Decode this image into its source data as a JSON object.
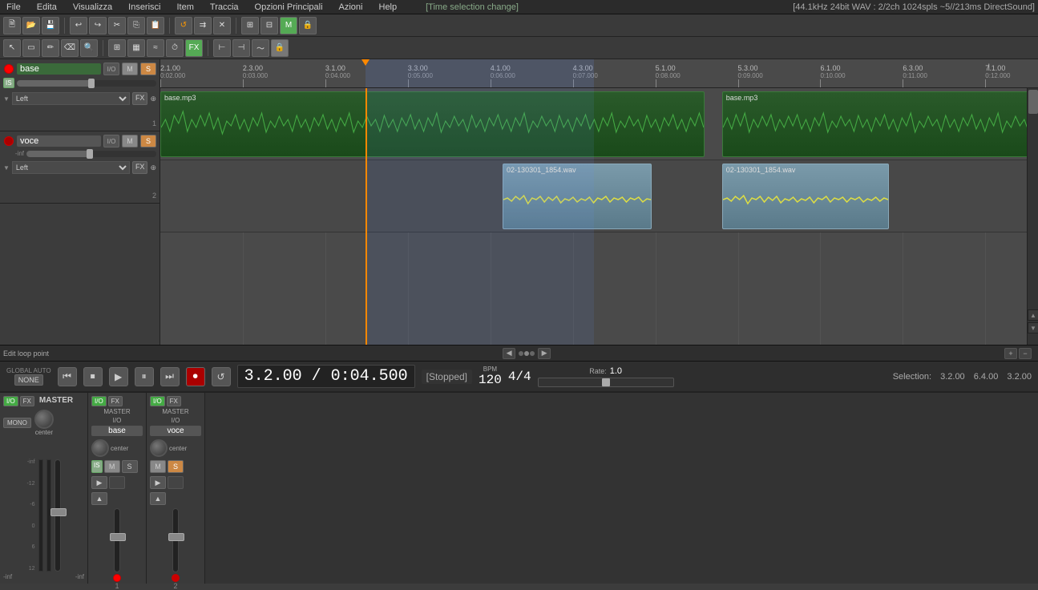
{
  "menu": {
    "items": [
      "File",
      "Edita",
      "Visualizza",
      "Inserisci",
      "Item",
      "Traccia",
      "Opzioni Principali",
      "Azioni",
      "Help"
    ]
  },
  "status_info": "[Time selection change]",
  "audio_info": "[44.1kHz 24bit WAV : 2/2ch 1024spls ~5//213ms DirectSound]",
  "toolbar": {
    "save_label": "Save",
    "open_label": "Open"
  },
  "ruler": {
    "marks": [
      {
        "label": "2.1.00",
        "sub": "0:02.000",
        "pos_pct": 0
      },
      {
        "label": "2.3.00",
        "sub": "0:03.000",
        "pos_pct": 9.4
      },
      {
        "label": "3.1.00",
        "sub": "0:04.000",
        "pos_pct": 18.8
      },
      {
        "label": "3.3.00",
        "sub": "0:05.000",
        "pos_pct": 28.2
      },
      {
        "label": "4.1.00",
        "sub": "0:06.000",
        "pos_pct": 37.6
      },
      {
        "label": "4.3.00",
        "sub": "0:07.000",
        "pos_pct": 47.0
      },
      {
        "label": "5.1.00",
        "sub": "0:08.000",
        "pos_pct": 56.4
      },
      {
        "label": "5.3.00",
        "sub": "0:09.000",
        "pos_pct": 65.8
      },
      {
        "label": "6.1.00",
        "sub": "0:10.000",
        "pos_pct": 75.2
      },
      {
        "label": "6.3.00",
        "sub": "0:11.000",
        "pos_pct": 84.6
      },
      {
        "label": "7.1.00",
        "sub": "0:12.000",
        "pos_pct": 94.0
      }
    ],
    "playhead_pct": 23.4
  },
  "tracks": [
    {
      "id": 1,
      "name": "base",
      "io": "I/O",
      "mute": "M",
      "solo": "S",
      "pan": "Left",
      "vol_label": "IS",
      "track_num": "1",
      "clips": [
        {
          "label": "base.mp3",
          "start_pct": 0,
          "width_pct": 62,
          "color": "green"
        },
        {
          "label": "base.mp3",
          "start_pct": 64,
          "width_pct": 36,
          "color": "green"
        }
      ]
    },
    {
      "id": 2,
      "name": "voce",
      "io": "I/O",
      "mute": "M",
      "solo": "S",
      "pan": "Left",
      "vol_label": "-inf",
      "track_num": "2",
      "clips": [
        {
          "label": "02-130301_1854.wav",
          "start_pct": 39,
          "width_pct": 17,
          "color": "blue"
        },
        {
          "label": "02-130301_1854.wav",
          "start_pct": 64,
          "width_pct": 19,
          "color": "blue"
        }
      ]
    }
  ],
  "transport": {
    "time": "3.2.00 / 0:04.500",
    "status": "[Stopped]",
    "bpm_label": "BPM",
    "bpm": "120",
    "time_sig": "4/4",
    "rate_label": "Rate:",
    "rate_value": "1.0",
    "selection_label": "Selection:",
    "selection_start": "3.2.00",
    "selection_end": "6.4.00",
    "selection_len": "3.2.00",
    "global_auto": "GLOBAL AUTO",
    "none_label": "NONE",
    "btn_rewind": "⏮",
    "btn_stop": "⏹",
    "btn_play": "▶",
    "btn_pause": "⏸",
    "btn_skip": "⏭",
    "btn_record": "⏺",
    "btn_loop": "↺"
  },
  "loop_bar": {
    "edit_label": "Edit loop point",
    "nav_left": "◀",
    "nav_right": "▶",
    "zoom_plus": "+",
    "zoom_minus": "−"
  },
  "mixer": {
    "master_label": "MASTER",
    "io_label": "I/O",
    "fx_label": "FX",
    "mono_label": "MONO",
    "center_label": "center",
    "channels": [
      {
        "name": "base",
        "master_label": "MASTER",
        "io": "I/O",
        "fx": "FX",
        "is_active": true,
        "number": "1"
      },
      {
        "name": "voce",
        "master_label": "MASTER",
        "io": "I/O",
        "fx": "FX",
        "is_active": false,
        "number": "2"
      }
    ],
    "db_labels": [
      "-inf",
      "-12",
      "-6",
      "6",
      "12"
    ]
  }
}
